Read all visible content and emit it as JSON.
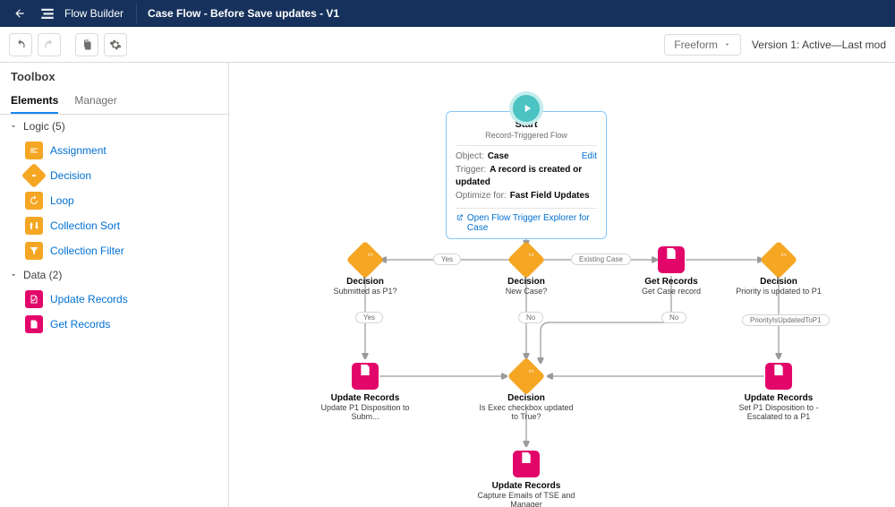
{
  "header": {
    "app_name": "Flow Builder",
    "flow_title": "Case Flow - Before Save updates - V1"
  },
  "toolbar": {
    "layout_mode": "Freeform",
    "version_text": "Version 1: Active—Last mod"
  },
  "sidebar": {
    "title": "Toolbox",
    "tabs": {
      "elements": "Elements",
      "manager": "Manager"
    },
    "logic": {
      "header": "Logic (5)",
      "items": [
        {
          "label": "Assignment"
        },
        {
          "label": "Decision"
        },
        {
          "label": "Loop"
        },
        {
          "label": "Collection Sort"
        },
        {
          "label": "Collection Filter"
        }
      ]
    },
    "data": {
      "header": "Data (2)",
      "items": [
        {
          "label": "Update Records"
        },
        {
          "label": "Get Records"
        }
      ]
    }
  },
  "start_card": {
    "title": "Start",
    "subtitle": "Record-Triggered Flow",
    "object_label": "Object:",
    "object_value": "Case",
    "trigger_label": "Trigger:",
    "trigger_value": "A record is created or updated",
    "optimize_label": "Optimize for:",
    "optimize_value": "Fast Field Updates",
    "edit": "Edit",
    "open_explorer": "Open Flow Trigger Explorer for Case"
  },
  "nodes": {
    "decision_new_case": {
      "title": "Decision",
      "sub": "New Case?"
    },
    "decision_submitted_p1": {
      "title": "Decision",
      "sub": "Submitted as P1?"
    },
    "get_case_record": {
      "title": "Get Records",
      "sub": "Get Case record"
    },
    "decision_priority_p1": {
      "title": "Decision",
      "sub": "Priority is updated to P1"
    },
    "update_p1_disposition": {
      "title": "Update Records",
      "sub": "Update P1 Disposition to Subm..."
    },
    "decision_exec_checkbox": {
      "title": "Decision",
      "sub": "Is Exec checkbox updated to True?"
    },
    "update_set_p1": {
      "title": "Update Records",
      "sub": "Set P1 Disposition to - Escalated to a P1"
    },
    "update_capture_emails": {
      "title": "Update Records",
      "sub": "Capture Emails of TSE and Manager"
    }
  },
  "edge_labels": {
    "yes_1": "Yes",
    "existing_case": "Existing Case",
    "yes_2": "Yes",
    "no_1": "No",
    "no_2": "No",
    "priority_updated": "PriorityIsUpdatedToP1"
  },
  "colors": {
    "orange": "#F5A623",
    "pink": "#e3066a",
    "link": "#0070d2",
    "header_bg": "#16325c"
  }
}
